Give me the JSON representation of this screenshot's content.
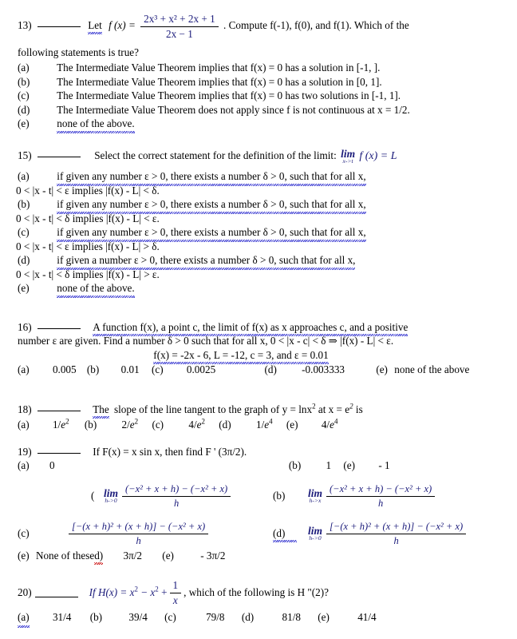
{
  "document": {
    "type": "calculus-multiple-choice-exam",
    "questions": [
      {
        "number": "13)",
        "stem_pre": "Let",
        "fn_label": "f (x) =",
        "fraction_numerator": "2x³ + x² + 2x + 1",
        "fraction_denominator": "2x − 1",
        "stem_post": ". Compute f(-1), f(0), and f(1). Which of the",
        "stem_line2": "following statements is true?",
        "choices": [
          {
            "tag": "(a)",
            "text": "The Intermediate Value Theorem implies that f(x) = 0 has a solution in [-1, ]."
          },
          {
            "tag": "(b)",
            "text": "The Intermediate Value Theorem implies that f(x) = 0 has a solution in [0, 1]."
          },
          {
            "tag": "(c)",
            "text": "The Intermediate Value Theorem implies that f(x) = 0 has two solutions in [-1, 1]."
          },
          {
            "tag": "(d)",
            "text": "The Intermediate Value Theorem does not apply since f is not continuous at x = 1/2."
          },
          {
            "tag": "(e)",
            "text": "none of the above."
          }
        ]
      },
      {
        "number": "15)",
        "stem": "Select the correct statement for the definition of the limit:",
        "limit_op": "lim",
        "limit_sub": "x->t",
        "limit_body": "f (x) = L",
        "choices": [
          {
            "tag": "(a)",
            "line1": "if given any number ε > 0, there exists a number δ > 0, such that for all x,",
            "line2": "0 < |x - t| < ε implies |f(x) - L| < δ."
          },
          {
            "tag": "(b)",
            "line1": "if given any number ε > 0, there exists a number δ > 0, such that for all x,",
            "line2": "0 < |x - t| < δ implies |f(x) - L| < ε."
          },
          {
            "tag": "(c)",
            "line1": "if given any number ε > 0, there exists a number δ > 0, such that for all x,",
            "line2": "0 < |x - t| < ε implies |f(x) - L| > δ."
          },
          {
            "tag": "(d)",
            "line1": "if given a number ε > 0, there exists a number δ > 0, such that for all x,",
            "line2": "0 < |x - t| < δ implies |f(x) - L| > ε."
          },
          {
            "tag": "(e)",
            "line1": "none of the above.",
            "line2": ""
          }
        ]
      },
      {
        "number": "16)",
        "line1": "A function f(x), a point c, the limit of f(x) as x approaches c, and a positive",
        "line2": "number ε are given. Find a number δ > 0 such that for all x, 0 < |x - c| < δ ⇒ |f(x) - L| < ε.",
        "line3": "f(x) = -2x - 6, L = -12, c = 3, and ε = 0.01",
        "choices": [
          {
            "tag": "(a)",
            "text": "0.005"
          },
          {
            "tag": "(b)",
            "text": "0.01"
          },
          {
            "tag": "(c)",
            "text": "0.0025"
          },
          {
            "tag": "(d)",
            "text": "-0.003333"
          },
          {
            "tag": "(e)",
            "text": "none of the above"
          }
        ]
      },
      {
        "number": "18)",
        "stem_a": "The",
        "stem_b": "slope of the line tangent to the graph of y = lnx",
        "stem_exp1": "2",
        "stem_c": " at x = e",
        "stem_exp2": "2",
        "stem_d": " is",
        "choices": [
          {
            "tag": "(a)",
            "num": "1/",
            "base": "e",
            "exp": "2"
          },
          {
            "tag": "(b)",
            "num": "2/",
            "base": "e",
            "exp": "2"
          },
          {
            "tag": "(c)",
            "num": "4/",
            "base": "e",
            "exp": "2"
          },
          {
            "tag": "(d)",
            "num": "1/",
            "base": "e",
            "exp": "4"
          },
          {
            "tag": "(e)",
            "num": "4/",
            "base": "e",
            "exp": "4"
          }
        ]
      },
      {
        "number": "19)",
        "stem": "If F(x) = x sin x, then find F ' (3π/2).",
        "choice_a_tag": "(a)",
        "choice_a_val": "0",
        "choice_b_tag": "(b)",
        "choice_b_val": "1",
        "choice_e_tag": "(e)",
        "choice_e_val": "- 1",
        "limit_choices": [
          {
            "tag": "(",
            "has_lim": true,
            "lim_sub": "h->0",
            "numerator": "(−x² + x + h) − (−x² + x)",
            "denominator": "h"
          },
          {
            "tag": "(b)",
            "has_lim": true,
            "lim_sub": "h->x",
            "numerator": "(−x² + x + h) − (−x² + x)",
            "denominator": "h"
          },
          {
            "tag": "(c)",
            "has_lim": false,
            "lim_sub": "",
            "numerator": "[−(x + h)² + (x + h)] − (−x² + x)",
            "denominator": "h"
          },
          {
            "tag": "(d)",
            "has_lim": true,
            "lim_sub": "h->0",
            "numerator": "[−(x + h)² + (x + h)] − (−x² + x)",
            "denominator": "h"
          }
        ],
        "final_line": {
          "none_tag": "(e)",
          "none_text": "None of these",
          "trailing_d": "d)",
          "val1": "3π/2",
          "tag2": "(e)",
          "val2": "- 3π/2"
        }
      },
      {
        "number": "20)",
        "stem_pre": "If H(x) = x",
        "exp1": "2",
        "stem_mid": " − x",
        "exp2": "2",
        "stem_plus": " +",
        "frac_num": "1",
        "frac_den": "x",
        "stem_post": ", which of the following is H \"(2)?",
        "choices": [
          {
            "tag": "(a)",
            "text": "31/4"
          },
          {
            "tag": "(b)",
            "text": "39/4"
          },
          {
            "tag": "(c)",
            "text": "79/8"
          },
          {
            "tag": "(d)",
            "text": "81/8"
          },
          {
            "tag": "(e)",
            "text": "41/4"
          }
        ]
      }
    ]
  }
}
